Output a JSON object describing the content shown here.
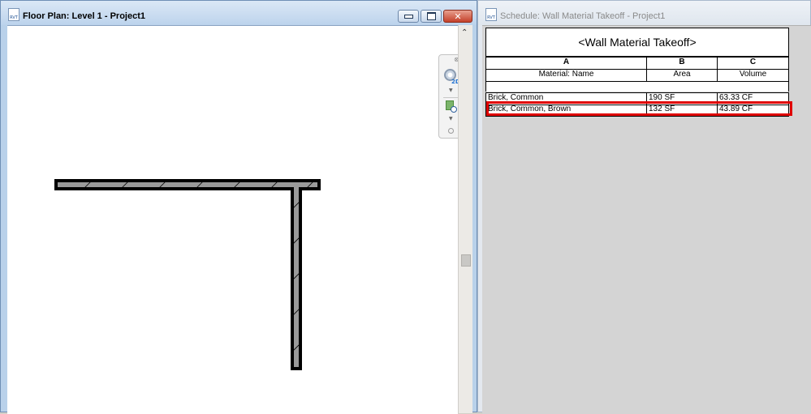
{
  "left_window": {
    "title": "Floor Plan: Level 1 - Project1",
    "icon_label": "RVT",
    "controls": {
      "minimize": "minimize-icon",
      "maximize": "maximize-icon",
      "close": "✕"
    },
    "nav_bar": {
      "badge": "2D"
    }
  },
  "right_window": {
    "title": "Schedule: Wall Material Takeoff - Project1",
    "icon_label": "RVT"
  },
  "schedule": {
    "title": "<Wall Material Takeoff>",
    "column_letters": [
      "A",
      "B",
      "C"
    ],
    "column_headers": [
      "Material: Name",
      "Area",
      "Volume"
    ],
    "rows": [
      {
        "name": "Brick, Common",
        "area": "190 SF",
        "volume": "63.33 CF"
      },
      {
        "name": "Brick, Common, Brown",
        "area": "132 SF",
        "volume": "43.89 CF"
      }
    ],
    "highlighted_row": 1,
    "highlight_color": "#e00000"
  }
}
